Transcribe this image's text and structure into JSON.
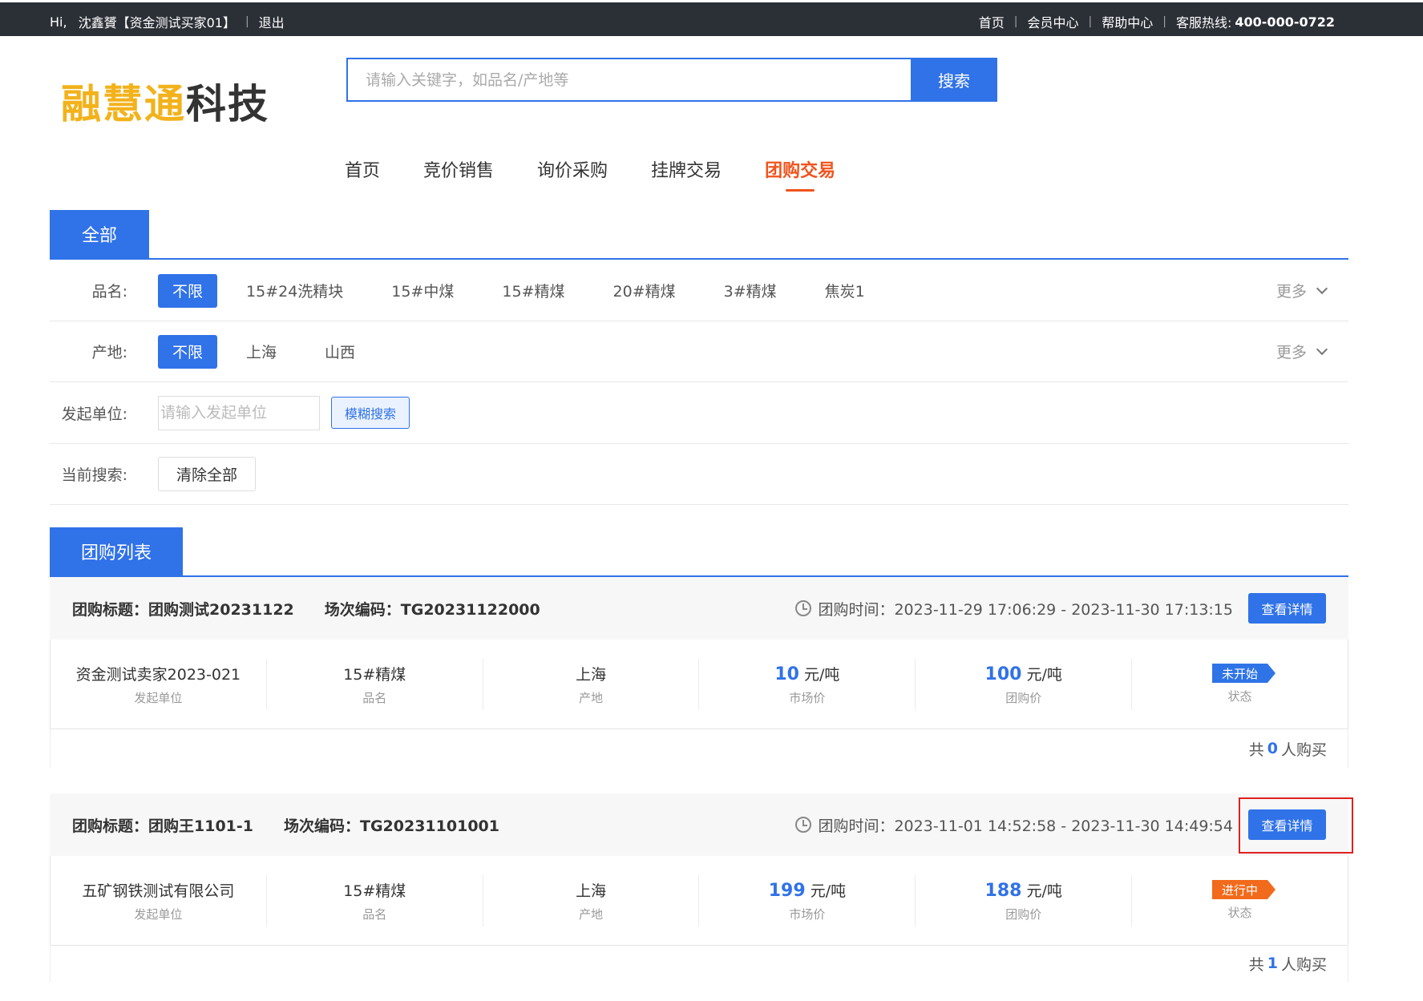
{
  "topbar": {
    "greeting": "Hi,",
    "user": "沈鑫贇【资金测试买家01】",
    "logout": "退出",
    "home": "首页",
    "member_center": "会员中心",
    "help_center": "帮助中心",
    "hotline_label": "客服热线:",
    "hotline_number": "400-000-0722"
  },
  "logo": {
    "part1": "融慧通",
    "part2": "科技"
  },
  "search": {
    "placeholder": "请输入关键字，如品名/产地等",
    "button": "搜索"
  },
  "nav": [
    "首页",
    "竞价销售",
    "询价采购",
    "挂牌交易",
    "团购交易"
  ],
  "nav_active": "团购交易",
  "filter_tab": "全部",
  "filters": {
    "product": {
      "label": "品名:",
      "options": [
        "不限",
        "15#24洗精块",
        "15#中煤",
        "15#精煤",
        "20#精煤",
        "3#精煤",
        "焦炭1"
      ],
      "more": "更多"
    },
    "origin": {
      "label": "产地:",
      "options": [
        "不限",
        "上海",
        "山西"
      ],
      "more": "更多"
    },
    "unit": {
      "label": "发起单位:",
      "placeholder": "请输入发起单位",
      "button": "模糊搜索"
    },
    "current": {
      "label": "当前搜索:",
      "button": "清除全部"
    }
  },
  "list_tab": "团购列表",
  "cards": [
    {
      "title": "团购标题：团购测试20231122",
      "code": "场次编码：TG20231122000",
      "time": "团购时间：2023-11-29 17:06:29 - 2023-11-30 17:13:15",
      "detail_button": "查看详情",
      "initiator": "资金测试卖家2023-021",
      "initiator_label": "发起单位",
      "product": "15#精煤",
      "product_label": "品名",
      "origin": "上海",
      "origin_label": "产地",
      "market_price": "10",
      "market_unit": "元/吨",
      "market_label": "市场价",
      "group_price": "100",
      "group_unit": "元/吨",
      "group_label": "团购价",
      "status": "未开始",
      "status_label": "状态",
      "buyers_prefix": "共",
      "buyers_count": "0",
      "buyers_suffix": "人购买"
    },
    {
      "title": "团购标题：团购王1101-1",
      "code": "场次编码：TG20231101001",
      "time": "团购时间：2023-11-01 14:52:58 - 2023-11-30 14:49:54",
      "detail_button": "查看详情",
      "initiator": "五矿钢铁测试有限公司",
      "initiator_label": "发起单位",
      "product": "15#精煤",
      "product_label": "品名",
      "origin": "上海",
      "origin_label": "产地",
      "market_price": "199",
      "market_unit": "元/吨",
      "market_label": "市场价",
      "group_price": "188",
      "group_unit": "元/吨",
      "group_label": "团购价",
      "status": "进行中",
      "status_label": "状态",
      "buyers_prefix": "共",
      "buyers_count": "1",
      "buyers_suffix": "人购买"
    }
  ],
  "colors": {
    "primary": "#3072e8",
    "accent": "#f0531c",
    "status_not_started": "#2f74e6",
    "status_ongoing": "#f26a1b",
    "highlight": "#e02020"
  }
}
